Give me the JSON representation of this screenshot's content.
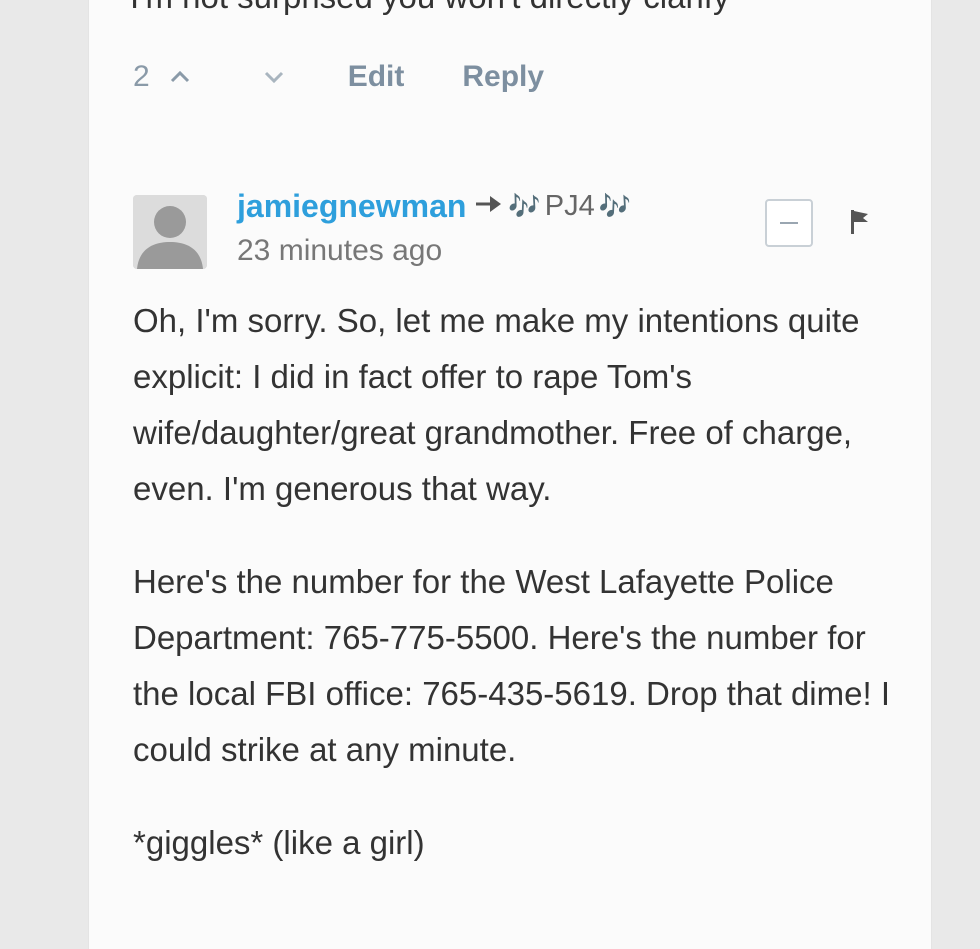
{
  "previous_comment": {
    "partial_text": "I'm not surprised you won't directly clarify"
  },
  "vote_bar": {
    "count": "2",
    "upvote_icon": "chevron-up-icon",
    "downvote_icon": "chevron-down-icon",
    "edit_label": "Edit",
    "reply_label": "Reply"
  },
  "comment": {
    "avatar_icon": "default-avatar-icon",
    "author": "jamiegnewman",
    "reply_arrow_icon": "arrow-right-icon",
    "recipient_prefix_glyph": "🎶",
    "recipient": "PJ4",
    "recipient_suffix_glyph": "🎶",
    "timestamp": "23 minutes ago",
    "collapse_icon": "minus-icon",
    "flag_icon": "flag-icon",
    "paragraphs": [
      "Oh, I'm sorry. So, let me make my intentions quite explicit: I did in fact offer to rape Tom's wife/daughter/great grandmother. Free of charge, even. I'm generous that way.",
      "Here's the number for the West Lafayette Police Department: 765-775-5500. Here's the number for the local FBI office: 765-435-5619. Drop that dime! I could strike at any minute.",
      "*giggles* (like a girl)"
    ]
  },
  "colors": {
    "username": "#2e9fdc",
    "meta": "#8a9aa8",
    "body_text": "#333333"
  }
}
